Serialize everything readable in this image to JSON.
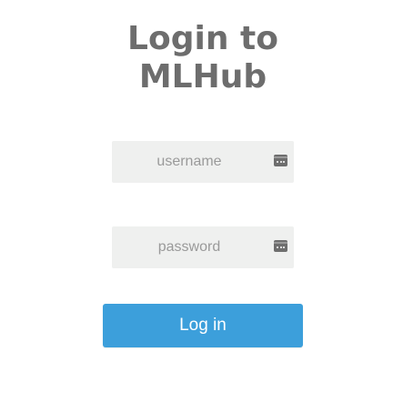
{
  "title": {
    "line1": "Login to",
    "line2": "MLHub"
  },
  "form": {
    "username_placeholder": "username",
    "username_value": "",
    "password_placeholder": "password",
    "password_value": "",
    "field_icon": "password-manager-icon",
    "login_label": "Log in"
  },
  "colors": {
    "title": "#6d6d6d",
    "field_background": "#eff0ef",
    "button": "#3c9fdb",
    "button_text": "#ffffff"
  }
}
